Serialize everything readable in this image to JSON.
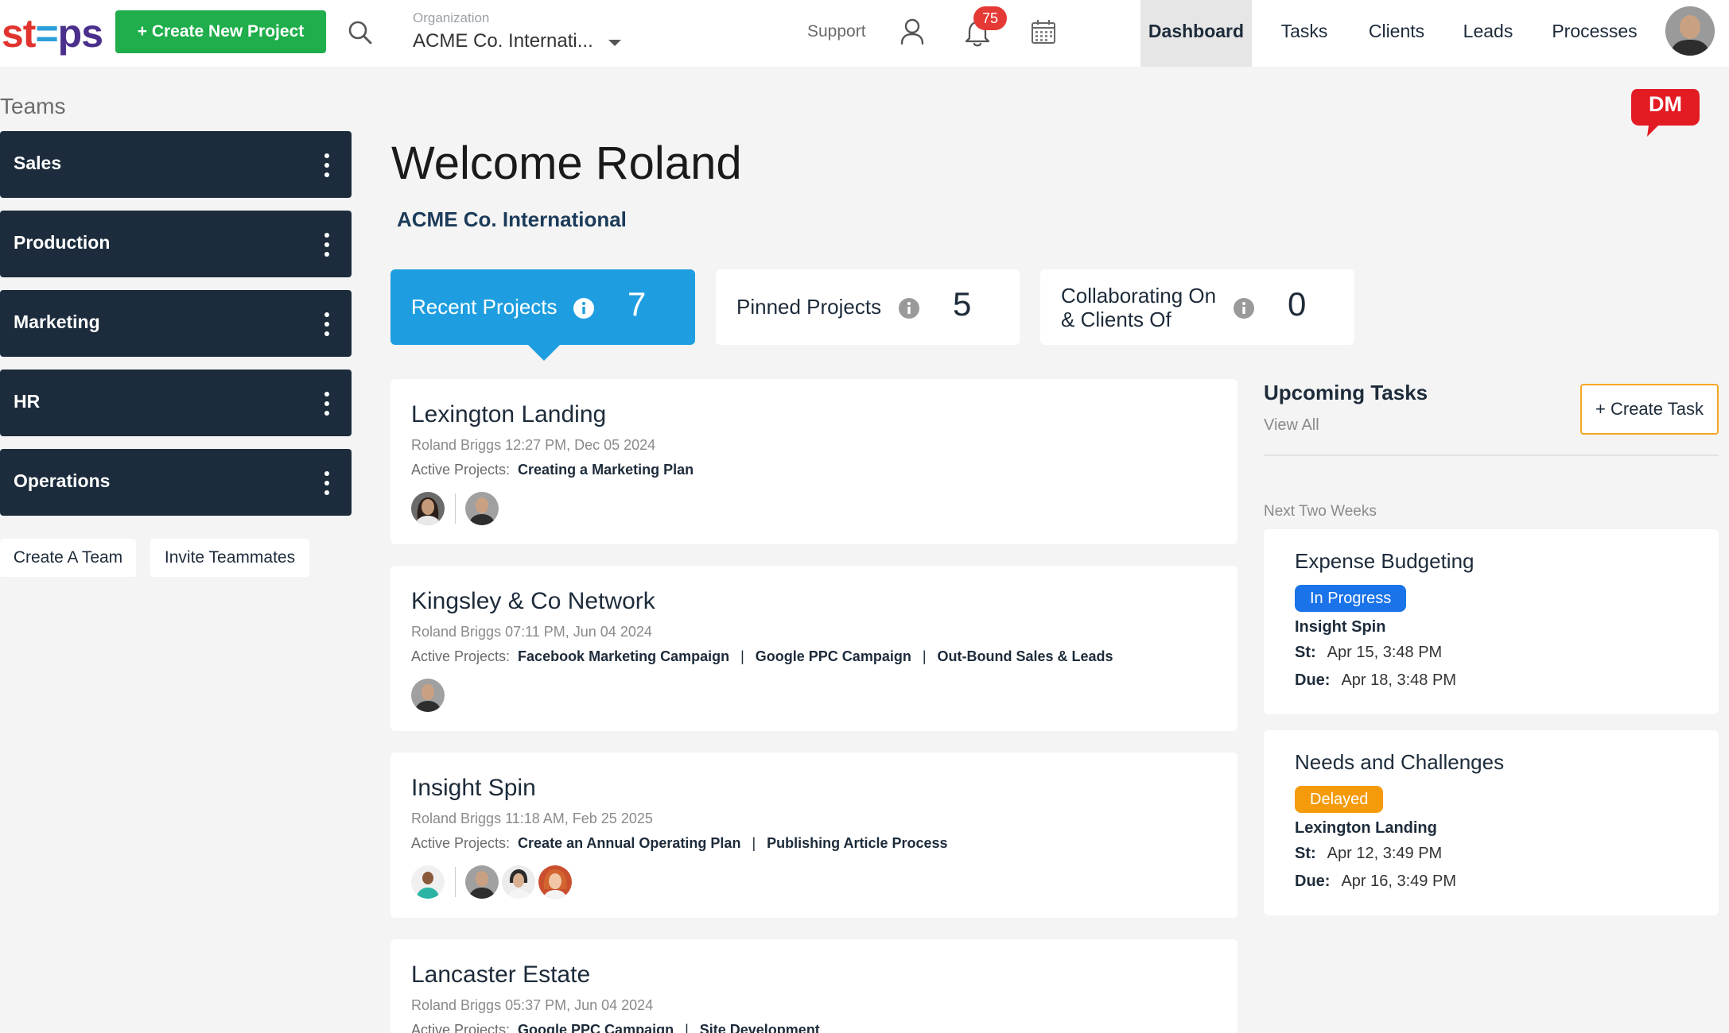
{
  "header": {
    "logo": {
      "st": "st",
      "e": "=",
      "ps": "ps"
    },
    "create_project_label": "+ Create New Project",
    "organization": {
      "label": "Organization",
      "value": "ACME Co. Internati..."
    },
    "support_label": "Support",
    "notification_count": "75",
    "nav": [
      {
        "label": "Dashboard",
        "active": true
      },
      {
        "label": "Tasks",
        "active": false
      },
      {
        "label": "Clients",
        "active": false
      },
      {
        "label": "Leads",
        "active": false
      },
      {
        "label": "Processes",
        "active": false
      }
    ],
    "icons": [
      "search-icon",
      "chevron-down-icon",
      "user-icon",
      "bell-icon",
      "calendar-icon"
    ]
  },
  "sidebar": {
    "title": "Teams",
    "teams": [
      {
        "label": "Sales"
      },
      {
        "label": "Production"
      },
      {
        "label": "Marketing"
      },
      {
        "label": "HR"
      },
      {
        "label": "Operations"
      }
    ],
    "create_team_label": "Create A Team",
    "invite_label": "Invite Teammates"
  },
  "main": {
    "dm_label": "DM",
    "welcome": "Welcome Roland",
    "org_name": "ACME Co. International",
    "stats": [
      {
        "label": "Recent Projects",
        "value": "7"
      },
      {
        "label": "Pinned Projects",
        "value": "5"
      },
      {
        "label_line1": "Collaborating On",
        "label_line2": "& Clients Of",
        "value": "0"
      }
    ],
    "active_projects_label": "Active Projects:",
    "projects": [
      {
        "title": "Lexington Landing",
        "meta": "Roland Briggs 12:27 PM, Dec 05 2024",
        "active": [
          "Creating a Marketing Plan"
        ]
      },
      {
        "title": "Kingsley & Co Network",
        "meta": "Roland Briggs 07:11 PM, Jun 04 2024",
        "active": [
          "Facebook Marketing Campaign",
          "Google PPC Campaign",
          "Out-Bound Sales & Leads"
        ]
      },
      {
        "title": "Insight Spin",
        "meta": "Roland Briggs 11:18 AM, Feb 25 2025",
        "active": [
          "Create an Annual Operating Plan",
          "Publishing Article Process"
        ]
      },
      {
        "title": "Lancaster Estate",
        "meta": "Roland Briggs 05:37 PM, Jun 04 2024",
        "active": [
          "Google PPC Campaign",
          "Site Development"
        ]
      }
    ]
  },
  "tasks": {
    "title": "Upcoming Tasks",
    "view_all": "View All",
    "create_label": "+ Create Task",
    "period_label": "Next Two Weeks",
    "start_label": "St:",
    "due_label": "Due:",
    "items": [
      {
        "title": "Expense Budgeting",
        "status": "In Progress",
        "status_color": "#1a73e8",
        "project": "Insight Spin",
        "start": "Apr 15, 3:48 PM",
        "due": "Apr 18, 3:48 PM"
      },
      {
        "title": "Needs and Challenges",
        "status": "Delayed",
        "status_color": "#f59b0b",
        "project": "Lexington Landing",
        "start": "Apr 12, 3:49 PM",
        "due": "Apr 16, 3:49 PM"
      }
    ]
  },
  "colors": {
    "brand_green": "#1fae4b",
    "brand_blue": "#1e9ee0",
    "sidebar_team_bg": "#1c2c3c",
    "notification_red": "#e53935"
  }
}
